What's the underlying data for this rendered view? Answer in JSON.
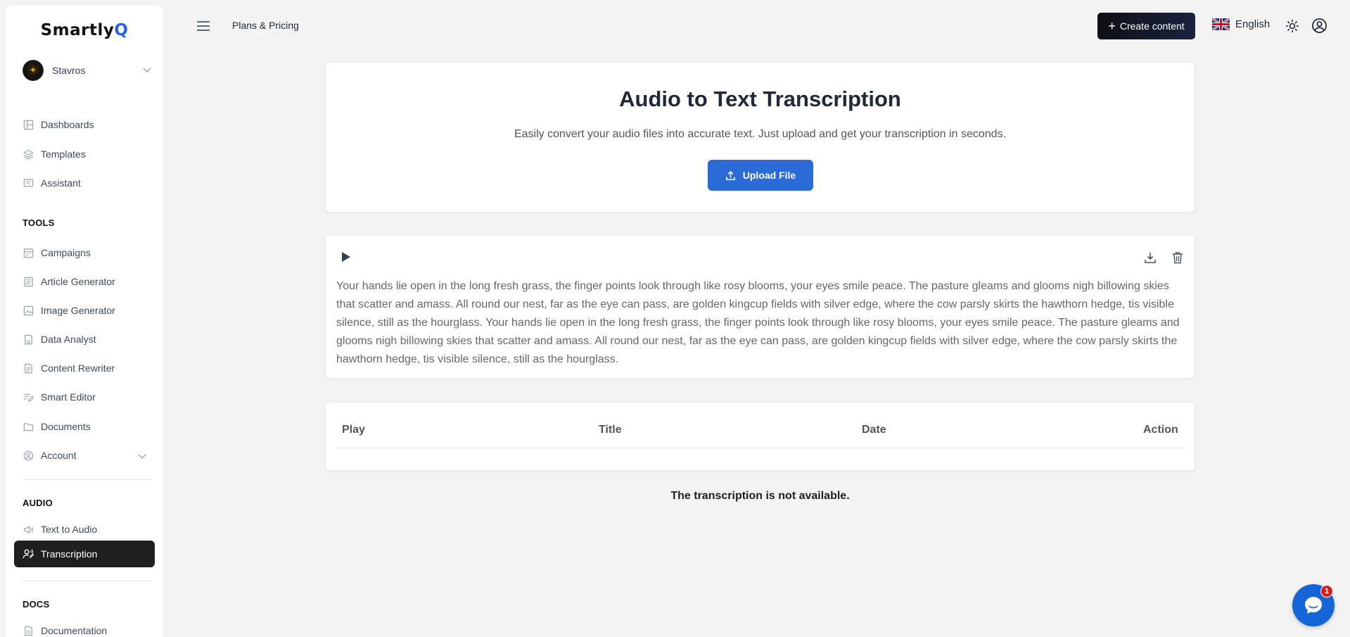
{
  "app": {
    "logo_main": "Smartly",
    "logo_accent": "Q"
  },
  "user": {
    "name": "Stavros"
  },
  "sidebar": {
    "main_items": [
      {
        "label": "Dashboards",
        "icon": "dashboard-icon"
      },
      {
        "label": "Templates",
        "icon": "layers-icon"
      },
      {
        "label": "Assistant",
        "icon": "chat-icon"
      }
    ],
    "tools_heading": "TOOLS",
    "tools_items": [
      {
        "label": "Campaigns",
        "icon": "calendar-icon"
      },
      {
        "label": "Article Generator",
        "icon": "article-icon"
      },
      {
        "label": "Image Generator",
        "icon": "image-icon"
      },
      {
        "label": "Data Analyst",
        "icon": "data-icon"
      },
      {
        "label": "Content Rewriter",
        "icon": "file-icon"
      },
      {
        "label": "Smart Editor",
        "icon": "edit-icon"
      },
      {
        "label": "Documents",
        "icon": "folder-icon"
      },
      {
        "label": "Account",
        "icon": "user-circle-icon"
      }
    ],
    "audio_heading": "AUDIO",
    "audio_items": [
      {
        "label": "Text to Audio",
        "icon": "speaker-icon"
      },
      {
        "label": "Transcription",
        "icon": "transcription-icon",
        "active": true
      }
    ],
    "docs_heading": "DOCS",
    "docs_items": [
      {
        "label": "Documentation",
        "icon": "document-icon"
      }
    ]
  },
  "header": {
    "plans_link": "Plans & Pricing",
    "create_button": "Create content",
    "language": "English"
  },
  "hero": {
    "title": "Audio to Text Transcription",
    "subtitle": "Easily convert your audio files into accurate text. Just upload and get your transcription in seconds.",
    "upload_button": "Upload File"
  },
  "player": {
    "transcript": "Your hands lie open in the long fresh grass, the finger points look through like rosy blooms, your eyes smile peace. The pasture gleams and glooms nigh billowing skies that scatter and amass. All round our nest, far as the eye can pass, are golden kingcup fields with silver edge, where the cow parsly skirts the hawthorn hedge, tis visible silence, still as the hourglass. Your hands lie open in the long fresh grass, the finger points look through like rosy blooms, your eyes smile peace. The pasture gleams and glooms nigh billowing skies that scatter and amass. All round our nest, far as the eye can pass, are golden kingcup fields with silver edge, where the cow parsly skirts the hawthorn hedge, tis visible silence, still as the hourglass."
  },
  "table": {
    "columns": [
      "Play",
      "Title",
      "Date",
      "Action"
    ],
    "empty_message": "The transcription is not available."
  },
  "chat": {
    "badge_count": "1"
  },
  "colors": {
    "accent": "#2a6bd8",
    "active_nav": "#1f1f1f",
    "badge": "#d91d1d",
    "chat": "#1565d8"
  }
}
